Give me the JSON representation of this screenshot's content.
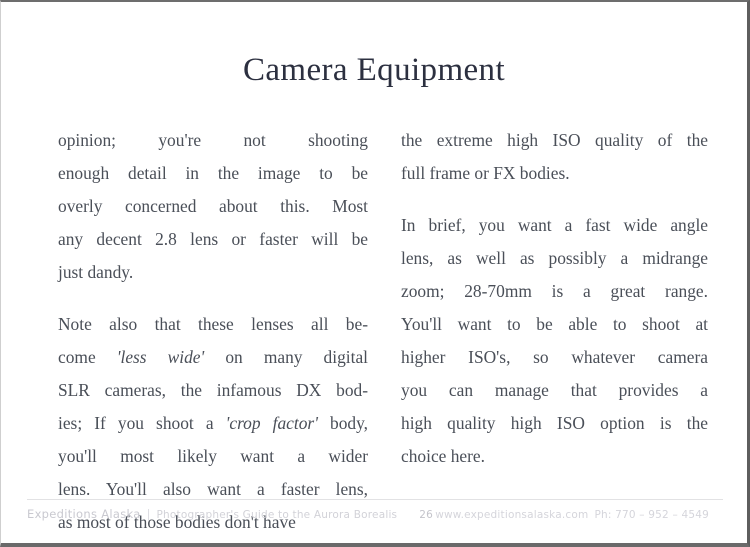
{
  "document": {
    "title": "Camera Equipment",
    "page_number": "26"
  },
  "body": {
    "left_column": [
      {
        "id": "para-opinion",
        "lines": [
          "opinion; you're not shooting",
          "enough detail in the image to be",
          "overly concerned about this. Most",
          "any decent 2.8 lens or faster will be",
          "just dandy."
        ]
      },
      {
        "id": "para-note-also",
        "lines": [
          "Note also that these lenses all be-",
          "come 'less wide' on many digital",
          "SLR cameras, the infamous DX bod-",
          "ies; If you shoot a 'crop factor' body,",
          "you'll most likely want a wider",
          "lens. You'll also want a faster lens,",
          "as most of those bodies don't have"
        ],
        "italic_phrases": [
          "'less wide'",
          "'crop factor'"
        ]
      }
    ],
    "right_column": [
      {
        "id": "para-extreme-iso",
        "lines": [
          "the extreme high ISO quality of the",
          "full frame or FX bodies."
        ]
      },
      {
        "id": "para-in-brief",
        "lines": [
          "In brief, you want a fast wide angle",
          "lens, as well as possibly a midrange",
          "zoom; 28-70mm is a great range.",
          "You'll want to be able to shoot at",
          "higher ISO's, so whatever camera",
          "you can manage that provides a",
          "high quality high ISO option is the",
          "choice here."
        ]
      }
    ]
  },
  "footer": {
    "brand": "Expeditions Alaska",
    "divider": "|",
    "subtitle": "Photographer's Guide to the Aurora Borealis",
    "page_number": "26",
    "website": "www.expeditionsalaska.com",
    "phone": "Ph: 770 – 952 – 4549"
  },
  "colors": {
    "title": "#2c3040",
    "body_text": "#4a4f58",
    "footer_text": "#d2d2d8",
    "page_background": "#ffffff",
    "border": "#6a6a6a"
  }
}
